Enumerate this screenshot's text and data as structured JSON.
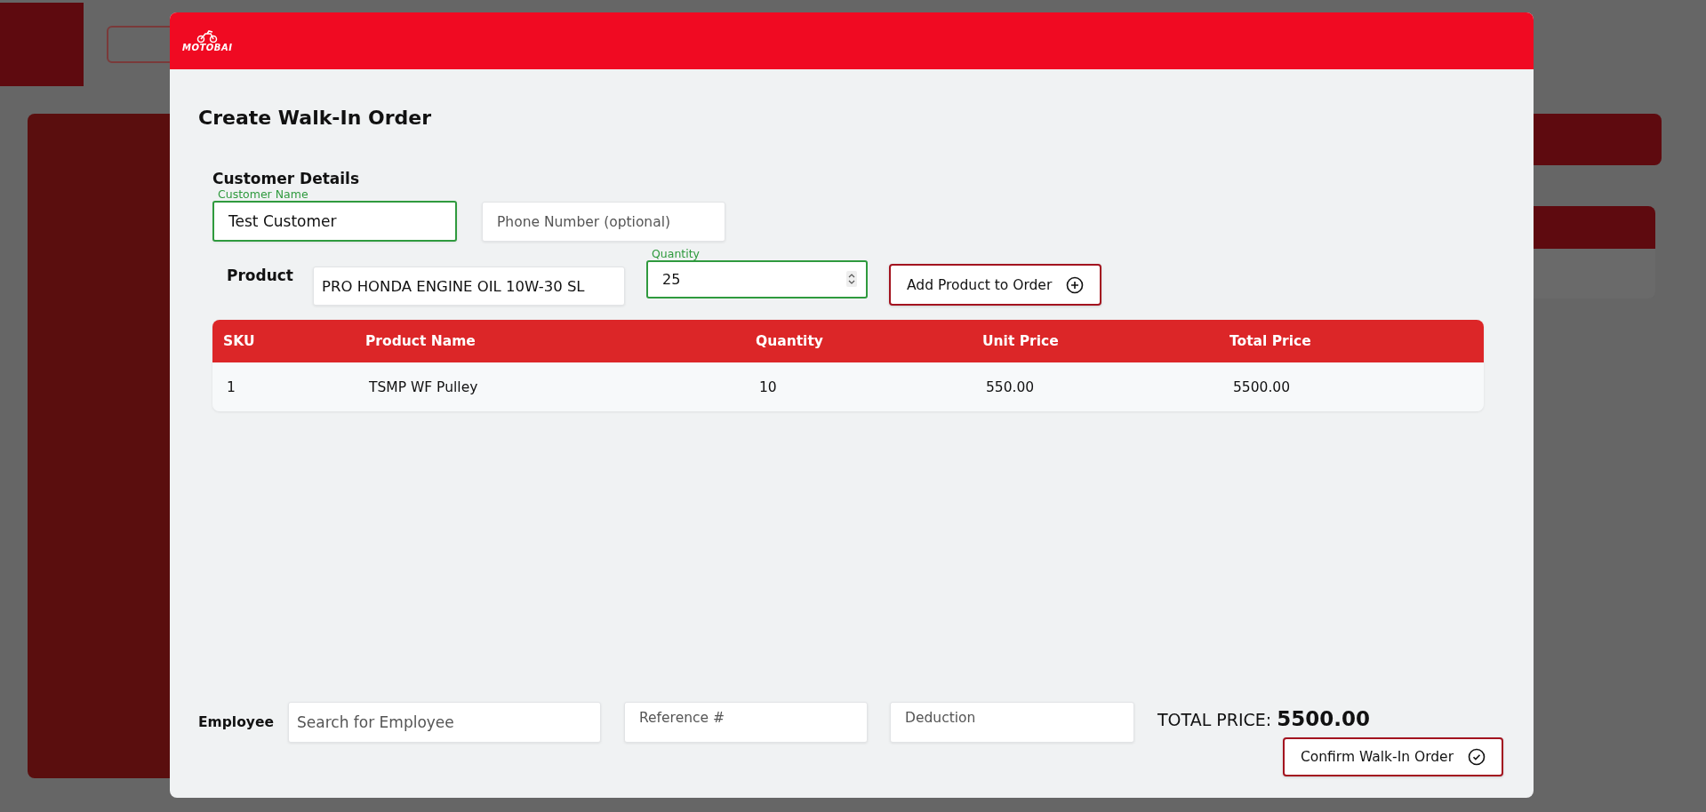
{
  "dialog": {
    "logo_text": "MOTOBAI",
    "title": "Create Walk-In Order",
    "customer_section": {
      "heading": "Customer Details",
      "customer_name": {
        "label": "Customer Name",
        "value": "Test Customer",
        "focused": true
      },
      "phone": {
        "placeholder": "Phone Number (optional)",
        "focused": false
      }
    },
    "product": {
      "label": "Product",
      "value": "PRO HONDA ENGINE OIL 10W-30 SL"
    },
    "quantity": {
      "label": "Quantity",
      "value": "25",
      "focused": true
    },
    "add_button": "Add Product to Order",
    "table": {
      "columns": [
        "SKU",
        "Product Name",
        "Quantity",
        "Unit Price",
        "Total Price"
      ],
      "rows": [
        [
          "1",
          "TSMP WF Pulley",
          "10",
          "550.00",
          "5500.00"
        ]
      ]
    },
    "employee": {
      "label": "Employee",
      "placeholder": "Search for Employee"
    },
    "reference": {
      "placeholder": "Reference #"
    },
    "deduction": {
      "placeholder": "Deduction"
    },
    "total": {
      "label": "TOTAL PRICE:",
      "value": "5500.00"
    },
    "confirm_button": "Confirm Walk-In Order"
  }
}
